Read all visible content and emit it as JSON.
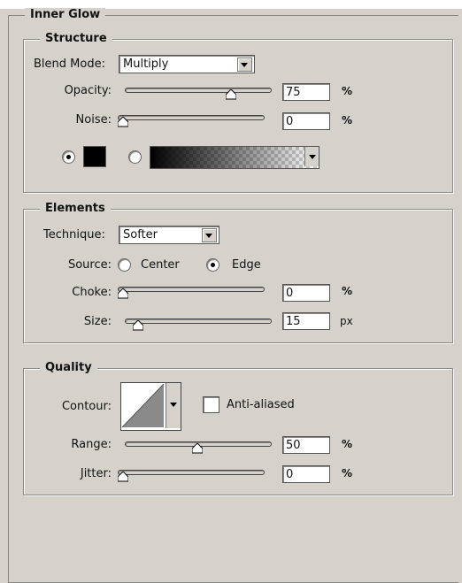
{
  "panel": {
    "title": "Inner Glow"
  },
  "structure": {
    "title": "Structure",
    "blend_mode": {
      "label": "Blend Mode:",
      "value": "Multiply"
    },
    "opacity": {
      "label": "Opacity:",
      "value": "75",
      "unit": "%",
      "level": 0.75
    },
    "noise": {
      "label": "Noise:",
      "value": "0",
      "unit": "%",
      "level": 0
    },
    "fill": {
      "color_selected": true,
      "color": "#000000",
      "gradient_selected": false
    }
  },
  "elements": {
    "title": "Elements",
    "technique": {
      "label": "Technique:",
      "value": "Softer"
    },
    "source": {
      "label": "Source:",
      "center": "Center",
      "edge": "Edge",
      "selected": "edge"
    },
    "choke": {
      "label": "Choke:",
      "value": "0",
      "unit": "%",
      "level": 0
    },
    "size": {
      "label": "Size:",
      "value": "15",
      "unit": "px",
      "level": 0.06
    }
  },
  "quality": {
    "title": "Quality",
    "contour": {
      "label": "Contour:"
    },
    "anti_aliased": {
      "label": "Anti-aliased",
      "checked": false
    },
    "range": {
      "label": "Range:",
      "value": "50",
      "unit": "%",
      "level": 0.5
    },
    "jitter": {
      "label": "Jitter:",
      "value": "0",
      "unit": "%",
      "level": 0
    }
  }
}
